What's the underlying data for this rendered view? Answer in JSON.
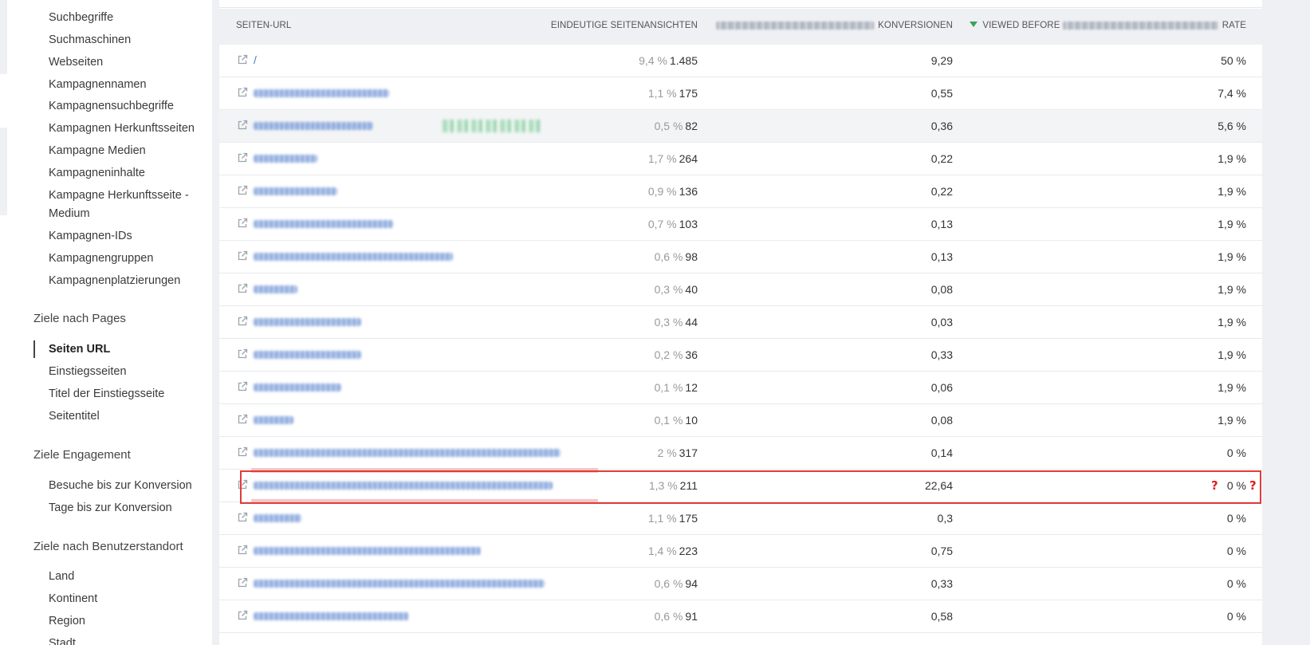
{
  "sidebar": {
    "items_top": [
      {
        "label": "Suchbegriffe"
      },
      {
        "label": "Suchmaschinen"
      },
      {
        "label": "Webseiten"
      },
      {
        "label": "Kampagnennamen"
      },
      {
        "label": "Kampagnensuchbegriffe"
      },
      {
        "label": "Kampagnen Herkunftsseiten"
      },
      {
        "label": "Kampagne Medien"
      },
      {
        "label": "Kampagneninhalte"
      },
      {
        "label": "Kampagne Herkunftsseite - Medium"
      },
      {
        "label": "Kampagnen-IDs"
      },
      {
        "label": "Kampagnengruppen"
      },
      {
        "label": "Kampagnenplatzierungen"
      }
    ],
    "section_pages": "Ziele nach Pages",
    "items_pages": [
      {
        "label": "Seiten URL",
        "active": true
      },
      {
        "label": "Einstiegsseiten"
      },
      {
        "label": "Titel der Einstiegsseite"
      },
      {
        "label": "Seitentitel"
      }
    ],
    "section_engagement": "Ziele Engagement",
    "items_engagement": [
      {
        "label": "Besuche bis zur Konversion"
      },
      {
        "label": "Tage bis zur Konversion"
      }
    ],
    "section_location": "Ziele nach Benutzerstandort",
    "items_location": [
      {
        "label": "Land"
      },
      {
        "label": "Kontinent"
      },
      {
        "label": "Region"
      },
      {
        "label": "Stadt"
      }
    ]
  },
  "table": {
    "headers": {
      "url": "SEITEN-URL",
      "views": "EINDEUTIGE SEITENANSICHTEN",
      "conversions": "KONVERSIONEN",
      "rate_prefix": "VIEWED BEFORE",
      "rate_suffix": "RATE"
    },
    "rows": [
      {
        "url": "/",
        "pct": "9,4 %",
        "views": "1.485",
        "conv": "9,29",
        "rate": "50 %"
      },
      {
        "url": "",
        "pct": "1,1 %",
        "views": "175",
        "conv": "0,55",
        "rate": "7,4 %"
      },
      {
        "url": "",
        "pct": "0,5 %",
        "views": "82",
        "conv": "0,36",
        "rate": "5,6 %"
      },
      {
        "url": "",
        "pct": "1,7 %",
        "views": "264",
        "conv": "0,22",
        "rate": "1,9 %"
      },
      {
        "url": "",
        "pct": "0,9 %",
        "views": "136",
        "conv": "0,22",
        "rate": "1,9 %"
      },
      {
        "url": "",
        "pct": "0,7 %",
        "views": "103",
        "conv": "0,13",
        "rate": "1,9 %"
      },
      {
        "url": "",
        "pct": "0,6 %",
        "views": "98",
        "conv": "0,13",
        "rate": "1,9 %"
      },
      {
        "url": "",
        "pct": "0,3 %",
        "views": "40",
        "conv": "0,08",
        "rate": "1,9 %"
      },
      {
        "url": "",
        "pct": "0,3 %",
        "views": "44",
        "conv": "0,03",
        "rate": "1,9 %"
      },
      {
        "url": "",
        "pct": "0,2 %",
        "views": "36",
        "conv": "0,33",
        "rate": "1,9 %"
      },
      {
        "url": "",
        "pct": "0,1 %",
        "views": "12",
        "conv": "0,06",
        "rate": "1,9 %"
      },
      {
        "url": "",
        "pct": "0,1 %",
        "views": "10",
        "conv": "0,08",
        "rate": "1,9 %"
      },
      {
        "url": "",
        "pct": "2 %",
        "views": "317",
        "conv": "0,14",
        "rate": "0 %"
      },
      {
        "url": "",
        "pct": "1,3 %",
        "views": "211",
        "conv": "22,64",
        "rate": "0 %"
      },
      {
        "url": "",
        "pct": "1,1 %",
        "views": "175",
        "conv": "0,3",
        "rate": "0 %"
      },
      {
        "url": "",
        "pct": "1,4 %",
        "views": "223",
        "conv": "0,75",
        "rate": "0 %"
      },
      {
        "url": "",
        "pct": "0,6 %",
        "views": "94",
        "conv": "0,33",
        "rate": "0 %"
      },
      {
        "url": "",
        "pct": "0,6 %",
        "views": "91",
        "conv": "0,58",
        "rate": "0 %"
      }
    ]
  },
  "annotation": {
    "marker": "?"
  },
  "colors": {
    "link": "#4a78c2",
    "sort_arrow": "#3aa35a",
    "highlight": "#e23b3b"
  }
}
